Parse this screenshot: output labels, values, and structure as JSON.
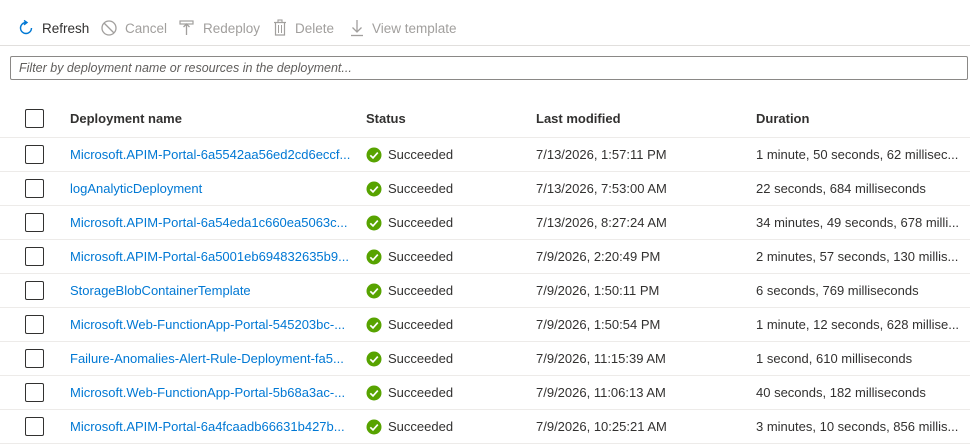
{
  "toolbar": {
    "refresh_label": "Refresh",
    "cancel_label": "Cancel",
    "redeploy_label": "Redeploy",
    "delete_label": "Delete",
    "view_template_label": "View template"
  },
  "filter": {
    "placeholder": "Filter by deployment name or resources in the deployment..."
  },
  "table": {
    "columns": [
      "Deployment name",
      "Status",
      "Last modified",
      "Duration"
    ],
    "rows": [
      {
        "name": "Microsoft.APIM-Portal-6a5542aa56ed2cd6eccf...",
        "status": "Succeeded",
        "modified": "7/13/2026, 1:57:11 PM",
        "duration": "1 minute, 50 seconds, 62 millisec..."
      },
      {
        "name": "logAnalyticDeployment",
        "status": "Succeeded",
        "modified": "7/13/2026, 7:53:00 AM",
        "duration": "22 seconds, 684 milliseconds"
      },
      {
        "name": "Microsoft.APIM-Portal-6a54eda1c660ea5063c...",
        "status": "Succeeded",
        "modified": "7/13/2026, 8:27:24 AM",
        "duration": "34 minutes, 49 seconds, 678 milli..."
      },
      {
        "name": "Microsoft.APIM-Portal-6a5001eb694832635b9...",
        "status": "Succeeded",
        "modified": "7/9/2026, 2:20:49 PM",
        "duration": "2 minutes, 57 seconds, 130 millis..."
      },
      {
        "name": "StorageBlobContainerTemplate",
        "status": "Succeeded",
        "modified": "7/9/2026, 1:50:11 PM",
        "duration": "6 seconds, 769 milliseconds"
      },
      {
        "name": "Microsoft.Web-FunctionApp-Portal-545203bc-...",
        "status": "Succeeded",
        "modified": "7/9/2026, 1:50:54 PM",
        "duration": "1 minute, 12 seconds, 628 millise..."
      },
      {
        "name": "Failure-Anomalies-Alert-Rule-Deployment-fa5...",
        "status": "Succeeded",
        "modified": "7/9/2026, 11:15:39 AM",
        "duration": "1 second, 610 milliseconds"
      },
      {
        "name": "Microsoft.Web-FunctionApp-Portal-5b68a3ac-...",
        "status": "Succeeded",
        "modified": "7/9/2026, 11:06:13 AM",
        "duration": "40 seconds, 182 milliseconds"
      },
      {
        "name": "Microsoft.APIM-Portal-6a4fcaadb66631b427b...",
        "status": "Succeeded",
        "modified": "7/9/2026, 10:25:21 AM",
        "duration": "3 minutes, 10 seconds, 856 millis..."
      }
    ]
  },
  "colors": {
    "accent": "#0078d4",
    "success": "#57a300",
    "disabled": "#a19f9d"
  }
}
